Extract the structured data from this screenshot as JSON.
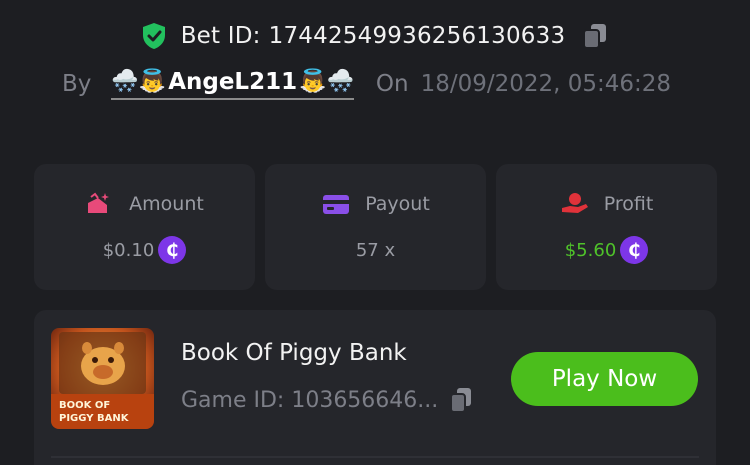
{
  "bet": {
    "label": "Bet ID:",
    "id": "17442549936256130633"
  },
  "author": {
    "by_label": "By",
    "emoji_left": "🌨️👼",
    "name": "AngeL211",
    "emoji_right": "👼🌨️",
    "on_label": "On",
    "date": "18/09/2022, 05:46:28"
  },
  "stats": {
    "amount": {
      "label": "Amount",
      "value": "$0.10",
      "icon": "amount-icon"
    },
    "payout": {
      "label": "Payout",
      "value": "57 x",
      "icon": "card-icon"
    },
    "profit": {
      "label": "Profit",
      "value": "$5.60",
      "icon": "hand-icon"
    }
  },
  "coin_glyph": "₵",
  "game": {
    "title": "Book Of Piggy Bank",
    "id_text": "Game ID: 103656646...",
    "thumb_line1": "BOOK OF",
    "thumb_line2": "PIGGY BANK",
    "play_label": "Play Now"
  },
  "colors": {
    "background": "#1d1e22",
    "card": "#25262b",
    "accent_green": "#4bbe1c",
    "coin_purple": "#7d36e8",
    "profit_green": "#4fc22a"
  }
}
